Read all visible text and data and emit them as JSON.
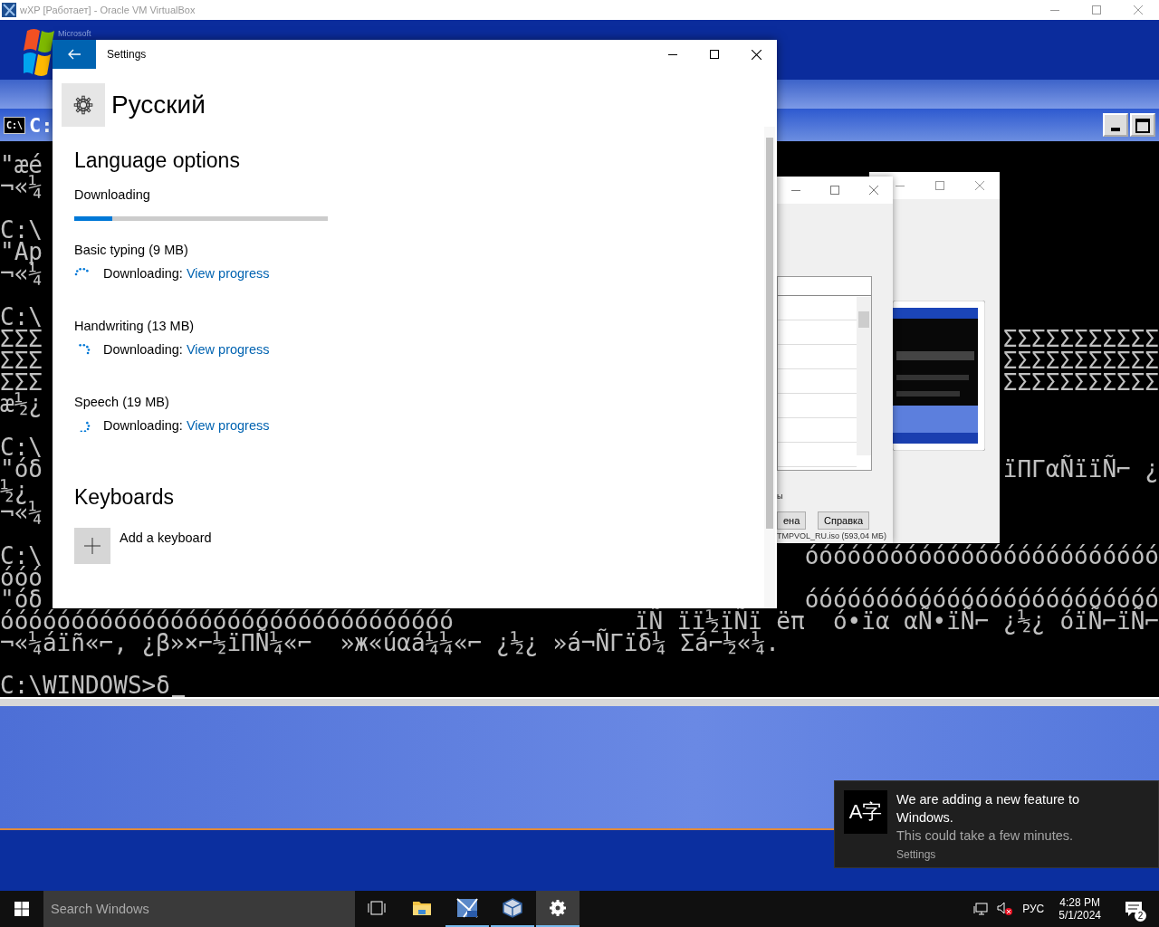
{
  "host_window": {
    "title": "wXP [Работает] - Oracle VM VirtualBox"
  },
  "vm": {
    "banner": {
      "text": "Microsoft"
    },
    "console": {
      "icon_text": "C:\\",
      "title": "C:",
      "lines": [
        {
          "left": "\"æé",
          "gap_before": false
        },
        {
          "left": "¬«¼",
          "gap_before": false
        },
        {
          "left": "C:\\",
          "gap_before": true
        },
        {
          "left": "\"Ap",
          "gap_before": false
        },
        {
          "left": "¬«¼",
          "gap_before": false
        },
        {
          "left": "C:\\",
          "gap_before": true
        },
        {
          "left": "ΣΣΣ",
          "right": "ΣΣΣΣΣΣΣΣΣΣΣ",
          "gap_before": false
        },
        {
          "left": "ΣΣΣ",
          "right": "ΣΣΣΣΣΣΣΣΣΣΣ",
          "gap_before": false
        },
        {
          "left": "ΣΣΣ",
          "right": "ΣΣΣΣΣΣΣΣΣΣΣ",
          "gap_before": false
        },
        {
          "left": "æ½¿",
          "gap_before": false
        },
        {
          "left": "C:\\",
          "gap_before": true
        },
        {
          "left": "\"óδ",
          "right": "ïΠΓαÑïïÑ⌐ ¿",
          "gap_before": false
        },
        {
          "left": "½¿",
          "gap_before": false
        },
        {
          "left": "¬«¼",
          "gap_before": false
        },
        {
          "left": "C:\\",
          "right": "óóóóóóóóóóóóóóóóóóóóóóóóó",
          "gap_before": true
        },
        {
          "left": "óóó",
          "gap_before": false
        },
        {
          "left": "\"óδ",
          "right": "óóóóóóóóóóóóóóóóóóóóóóóóó",
          "gap_before": false
        },
        {
          "left": "óóóóóóóóóóóóóóóóóóóóóóóóóóóóóóóó",
          "right": "ïÑ ïï½ïÑï ëπ  ó•ïα αÑ•ïÑ⌐ ¿½¿ óïÑ⌐ïÑ⌐",
          "gap_before": false
        },
        {
          "left": "¬«¼áïñ«⌐, ¿β»×⌐½ïΠÑ¼«⌐  »ж«úαá¼¼«⌐ ¿½¿ »á¬ÑΓïδ¼ Σá⌐½«¼.",
          "gap_before": false
        },
        {
          "left": "C:\\WINDOWS>δ",
          "gap_before": true
        }
      ]
    },
    "dialog": {
      "caption": "ы",
      "buttons": [
        "ена",
        "Справка"
      ],
      "status": "TMPVOL_RU.iso (593,04 МБ)"
    }
  },
  "settings": {
    "title": "Settings",
    "page_title": "Русский",
    "section": "Language options",
    "status": "Downloading",
    "level": 0.15,
    "features": [
      {
        "name": "Basic typing (9 MB)",
        "status": "Downloading:",
        "link": "View progress"
      },
      {
        "name": "Handwriting (13 MB)",
        "status": "Downloading:",
        "link": "View progress"
      },
      {
        "name": "Speech (19 MB)",
        "status": "Downloading:",
        "link": "View progress"
      }
    ],
    "keyboards": {
      "heading": "Keyboards",
      "add": "Add a keyboard"
    }
  },
  "toast": {
    "icon_glyph": "A字",
    "title": "We are adding a new feature to Windows.",
    "body": "This could take a few minutes.",
    "source": "Settings"
  },
  "taskbar": {
    "search_placeholder": "Search Windows",
    "apps": [
      {
        "kind": "task-view",
        "running": false,
        "selected": false
      },
      {
        "kind": "explorer",
        "running": false,
        "selected": false
      },
      {
        "kind": "xp",
        "running": true,
        "selected": false
      },
      {
        "kind": "virtualbox",
        "running": true,
        "selected": false
      },
      {
        "kind": "settings",
        "running": true,
        "selected": true
      }
    ],
    "language": "РУС",
    "time": "4:28 PM",
    "date": "5/1/2024",
    "notifications": "2"
  }
}
